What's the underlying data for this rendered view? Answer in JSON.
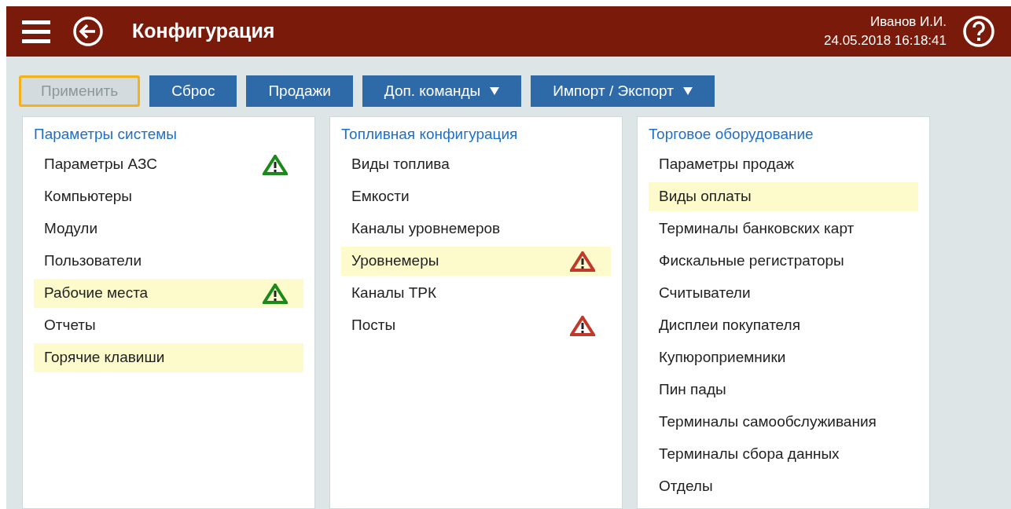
{
  "header": {
    "title": "Конфигурация",
    "user": "Иванов И.И.",
    "datetime": "24.05.2018 16:18:41"
  },
  "toolbar": [
    {
      "label": "Применить",
      "kind": "plain",
      "disabled": true,
      "focused": true
    },
    {
      "label": "Сброс",
      "kind": "plain",
      "disabled": false,
      "focused": false
    },
    {
      "label": "Продажи",
      "kind": "plain",
      "disabled": false,
      "focused": false
    },
    {
      "label": "Доп. команды",
      "kind": "dropdown",
      "disabled": false,
      "focused": false
    },
    {
      "label": "Импорт / Экспорт",
      "kind": "dropdown",
      "disabled": false,
      "focused": false
    }
  ],
  "panels": [
    {
      "title": "Параметры системы",
      "items": [
        {
          "label": "Параметры АЗС",
          "highlighted": false,
          "color": "#1a8a1a"
        },
        {
          "label": "Компьютеры",
          "highlighted": false
        },
        {
          "label": "Модули",
          "highlighted": false
        },
        {
          "label": "Пользователи",
          "highlighted": false
        },
        {
          "label": "Рабочие места",
          "highlighted": true,
          "color": "#1a8a1a"
        },
        {
          "label": "Отчеты",
          "highlighted": false
        },
        {
          "label": "Горячие клавиши",
          "highlighted": true
        }
      ]
    },
    {
      "title": "Топливная конфигурация",
      "items": [
        {
          "label": "Виды топлива",
          "highlighted": false
        },
        {
          "label": "Емкости",
          "highlighted": false
        },
        {
          "label": "Каналы уровнемеров",
          "highlighted": false
        },
        {
          "label": "Уровнемеры",
          "highlighted": true,
          "color": "#c0392b"
        },
        {
          "label": "Каналы ТРК",
          "highlighted": false
        },
        {
          "label": "Посты",
          "highlighted": false,
          "color": "#c0392b"
        }
      ]
    },
    {
      "title": "Торговое оборудование",
      "items": [
        {
          "label": "Параметры продаж",
          "highlighted": false
        },
        {
          "label": "Виды оплаты",
          "highlighted": true
        },
        {
          "label": "Терминалы банковских карт",
          "highlighted": false
        },
        {
          "label": "Фискальные регистраторы",
          "highlighted": false
        },
        {
          "label": "Считыватели",
          "highlighted": false
        },
        {
          "label": "Дисплеи покупателя",
          "highlighted": false
        },
        {
          "label": "Купюроприемники",
          "highlighted": false
        },
        {
          "label": "Пин пады",
          "highlighted": false
        },
        {
          "label": "Терминалы самообслуживания",
          "highlighted": false
        },
        {
          "label": "Терминалы сбора данных",
          "highlighted": false
        },
        {
          "label": "Отделы",
          "highlighted": false
        }
      ]
    }
  ]
}
